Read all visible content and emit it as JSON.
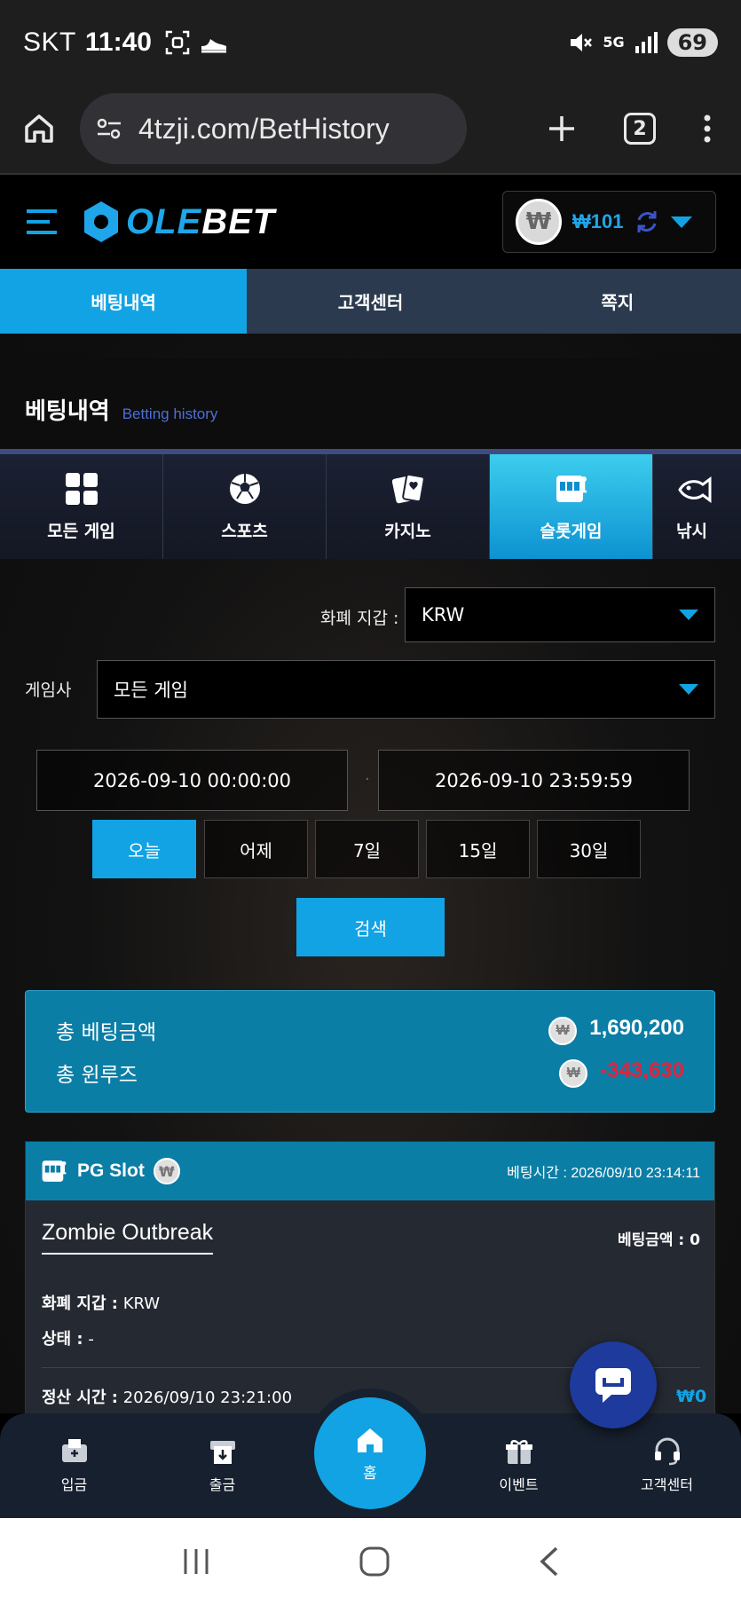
{
  "status": {
    "carrier": "SKT",
    "time": "11:40",
    "network": "5G",
    "battery": "69"
  },
  "browser": {
    "url": "4tzji.com/BetHistory",
    "tab_count": "2"
  },
  "header": {
    "logo_prefix": "OLE",
    "logo_suffix": "BET",
    "balance": "₩101",
    "coin_symbol": "₩"
  },
  "topnav": [
    {
      "label": "베팅내역",
      "active": true
    },
    {
      "label": "고객센터",
      "active": false
    },
    {
      "label": "쪽지",
      "active": false
    }
  ],
  "page": {
    "title": "베팅내역",
    "subtitle": "Betting history"
  },
  "categories": [
    {
      "label": "모든 게임",
      "icon": "grid-icon"
    },
    {
      "label": "스포츠",
      "icon": "soccer-ball-icon"
    },
    {
      "label": "카지노",
      "icon": "cards-icon"
    },
    {
      "label": "슬롯게임",
      "icon": "slot-machine-icon",
      "active": true
    },
    {
      "label": "낚시",
      "icon": "fish-icon"
    }
  ],
  "filters": {
    "currency_label": "화폐 지갑 :",
    "currency_value": "KRW",
    "provider_label": "게임사",
    "provider_value": "모든 게임",
    "date_from": "2026-09-10 00:00:00",
    "date_to": "2026-09-10 23:59:59",
    "quick_ranges": [
      "오늘",
      "어제",
      "7일",
      "15일",
      "30일"
    ],
    "quick_active": "오늘",
    "search_label": "검색"
  },
  "summary": {
    "total_bet_label": "총 베팅금액",
    "total_bet_value": "1,690,200",
    "total_winloss_label": "총 윈루즈",
    "total_winloss_value": "-343,630"
  },
  "bet_card": {
    "provider": "PG Slot",
    "bet_time_label": "베팅시간 :",
    "bet_time": "2026/09/10 23:14:11",
    "game": "Zombie Outbreak",
    "bet_amount_label": "베팅금액 :",
    "bet_amount": "0",
    "currency_label": "화폐 지갑 :",
    "currency": "KRW",
    "status_label": "상태 :",
    "status": "-",
    "settle_label": "정산 시간 :",
    "settle_time": "2026/09/10 23:21:00",
    "win_value": "₩0"
  },
  "bottom_nav": [
    {
      "label": "입금",
      "icon": "deposit-icon"
    },
    {
      "label": "출금",
      "icon": "withdraw-icon"
    },
    {
      "label": "홈",
      "icon": "home-icon"
    },
    {
      "label": "이벤트",
      "icon": "gift-icon"
    },
    {
      "label": "고객센터",
      "icon": "headset-icon"
    }
  ],
  "colors": {
    "accent": "#12a3e4",
    "negative": "#e0233c",
    "header_bg": "#000000",
    "nav_bg": "#2b3a4e"
  }
}
